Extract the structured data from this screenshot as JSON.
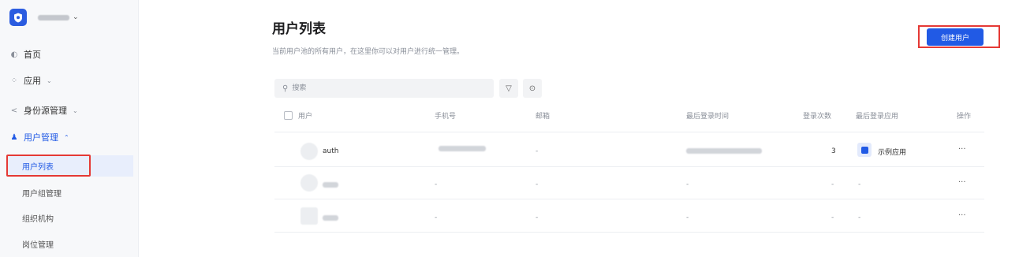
{
  "sidebar": {
    "items": [
      {
        "label": "首页",
        "icon": "dashboard-icon"
      },
      {
        "label": "应用",
        "icon": "apps-icon",
        "caret": "⌄"
      },
      {
        "label": "身份源管理",
        "icon": "share-icon",
        "caret": "⌄"
      },
      {
        "label": "用户管理",
        "icon": "users-icon",
        "caret": "⌃"
      }
    ],
    "sub_items": [
      "用户列表",
      "用户组管理",
      "组织机构",
      "岗位管理"
    ],
    "selected_sub_item": "用户列表"
  },
  "header": {
    "title": "用户列表",
    "description": "当前用户池的所有用户，在这里你可以对用户进行统一管理。",
    "create_button": "创建用户"
  },
  "toolbar": {
    "search_placeholder": "搜索"
  },
  "table": {
    "columns": [
      "用户",
      "手机号",
      "邮箱",
      "最后登录时间",
      "登录次数",
      "最后登录应用",
      "操作"
    ],
    "rows": [
      {
        "user": "auth",
        "phone": "",
        "email": "-",
        "last_login_time": "",
        "login_count": "3",
        "last_app": "示例应用",
        "actions": "···"
      },
      {
        "user": "",
        "phone": "-",
        "email": "-",
        "last_login_time": "-",
        "login_count": "-",
        "last_app": "-",
        "actions": "···"
      },
      {
        "user": "",
        "phone": "-",
        "email": "-",
        "last_login_time": "-",
        "login_count": "-",
        "last_app": "-",
        "actions": "···"
      }
    ]
  },
  "colors": {
    "accent": "#215ae5",
    "highlight_outline": "#e53935",
    "selected_bg": "#e8eefc"
  }
}
